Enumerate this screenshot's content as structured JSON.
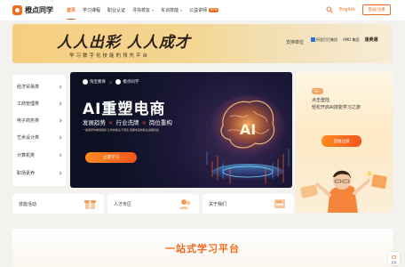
{
  "header": {
    "logo_text": "橙点同学",
    "nav": [
      {
        "label": "首页",
        "active": true
      },
      {
        "label": "学习课程"
      },
      {
        "label": "职业认证"
      },
      {
        "label": "寻找校友",
        "dropdown": true
      },
      {
        "label": "实训技能",
        "dropdown": true
      },
      {
        "label": "公益讲师",
        "badge": "NEW"
      }
    ],
    "language": "English",
    "login_label": "登录/注册"
  },
  "top_banner": {
    "slogan_main": "人人出彩 人人成才",
    "slogan_sub": "学习数字化技能的领先平台",
    "support_label": "支持单位",
    "sponsors": [
      "阿里巴巴集团",
      "AMD 集团",
      "速卖通"
    ]
  },
  "side_menu": {
    "items": [
      "经济贸易类",
      "工商管理类",
      "电子商务类",
      "艺术设计类",
      "计算机类",
      "职场素养"
    ]
  },
  "hero": {
    "partner_a": "淘宝教育",
    "partner_b": "橙点同学",
    "partner_separator": "×",
    "title": "AI重塑电商",
    "tagline": [
      "发展趋势",
      "行业洗牌",
      "岗位重构"
    ],
    "tagline_separator": "×",
    "description": "一堂课带你看懂趋势 让你的职业不落伍 把握未来的职业发展机会",
    "cta_label": "立即学习",
    "art_text": "AI"
  },
  "promo": {
    "badge": "Hi~",
    "line1": "点击登陆",
    "line2": "轻松开启AI技能学习之旅",
    "button_label": "登陆注册"
  },
  "quick_links": [
    {
      "label": "技能活动",
      "icon": "gift-box-icon"
    },
    {
      "label": "人才专区",
      "icon": "people-icon"
    },
    {
      "label": "关于我们",
      "icon": "info-card-icon"
    }
  ],
  "section": {
    "title": "一站式学习平台"
  },
  "float_tool": {
    "label": "反馈"
  },
  "colors": {
    "accent": "#f26b1d",
    "hero_bg": "#0d1022",
    "banner_bg": "#f6ce80"
  }
}
